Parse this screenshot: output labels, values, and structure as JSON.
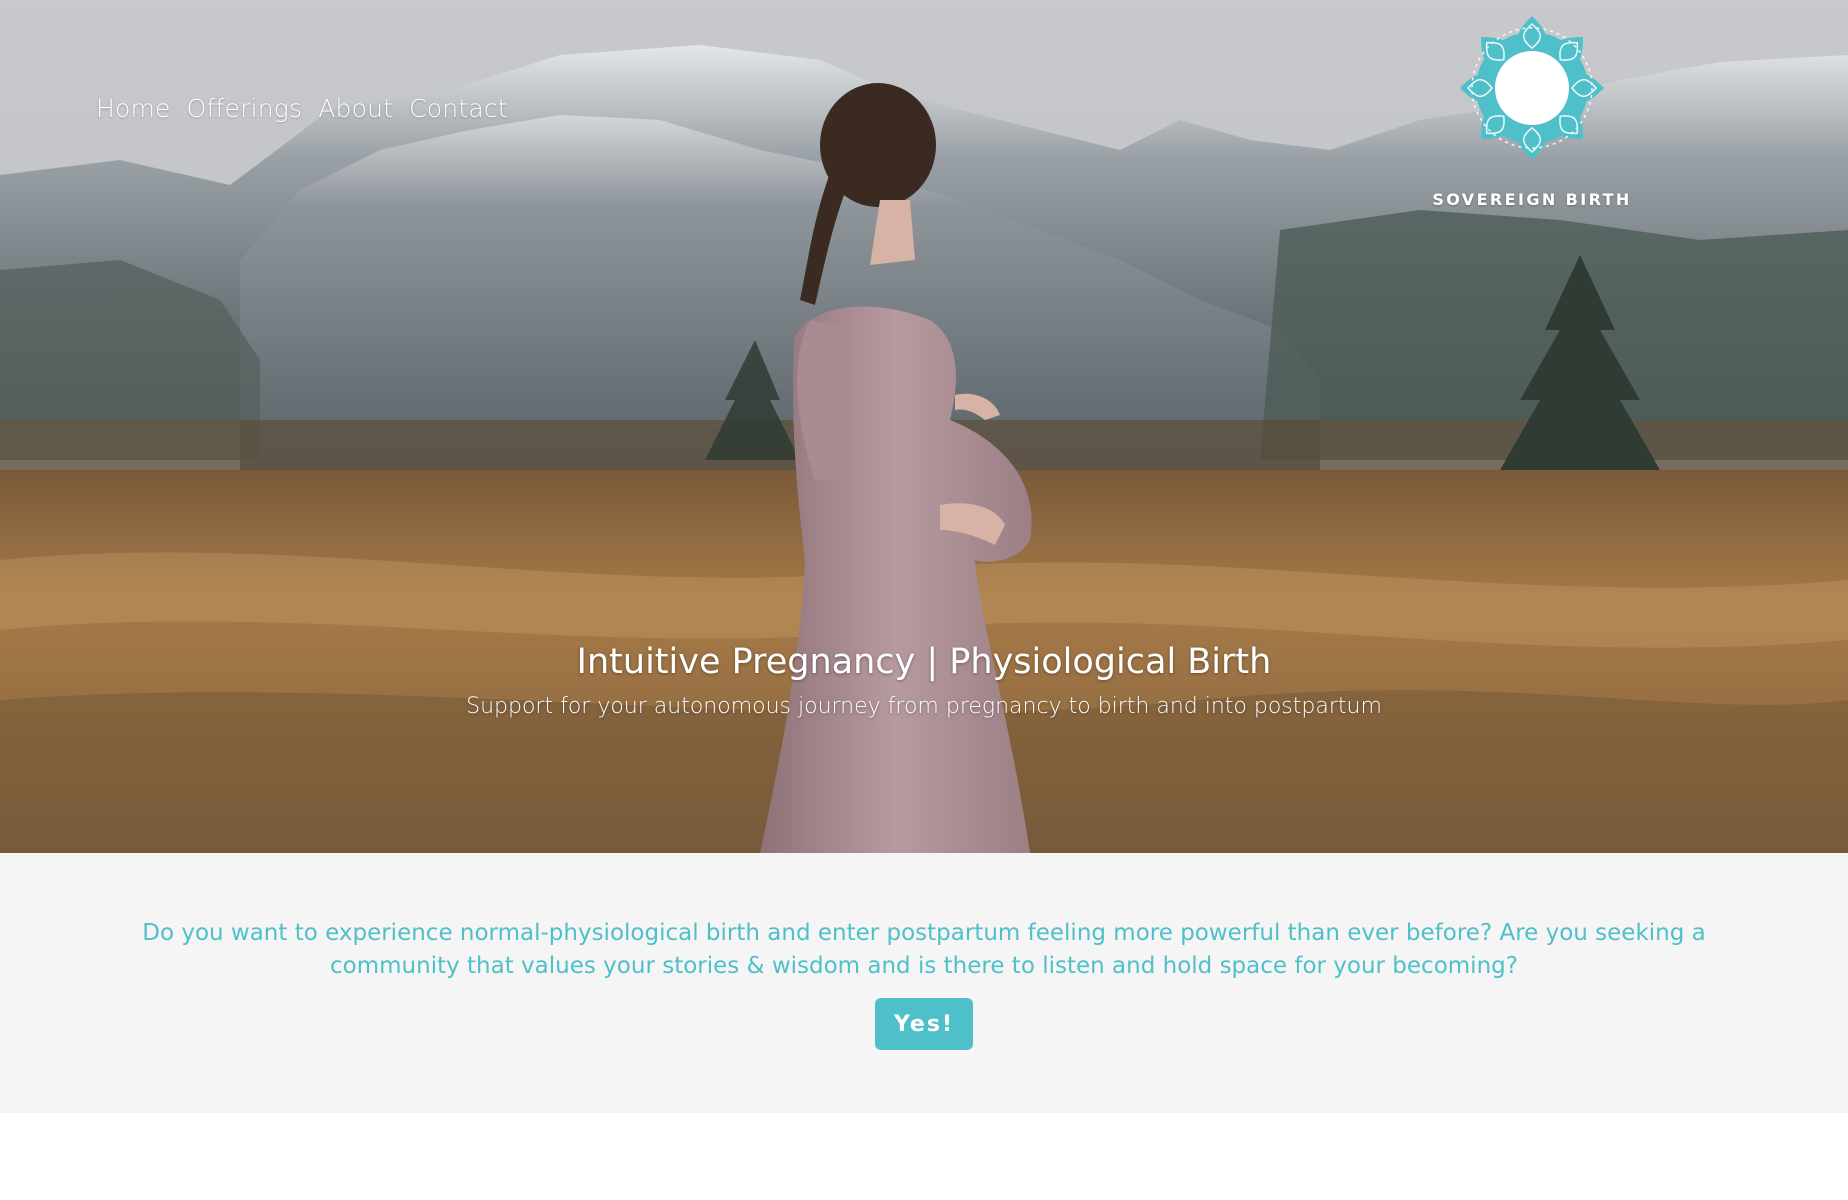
{
  "nav": {
    "items": [
      {
        "label": "Home"
      },
      {
        "label": "Offerings"
      },
      {
        "label": "About"
      },
      {
        "label": "Contact"
      }
    ]
  },
  "logo": {
    "icon": "mandala-icon",
    "text": "SOVEREIGN BIRTH"
  },
  "hero": {
    "title": "Intuitive Pregnancy | Physiological Birth",
    "subtitle": "Support for your autonomous journey from pregnancy to birth and into postpartum"
  },
  "cta": {
    "text": "Do you want to experience normal-physiological birth and enter postpartum feeling more powerful than ever before? Are you seeking a community that values your stories & wisdom and is there to listen and hold space for your becoming?",
    "button_label": "Yes!"
  },
  "colors": {
    "accent": "#4fc0c9",
    "section_background": "#f5f5f5",
    "page_background": "#ffffff"
  }
}
